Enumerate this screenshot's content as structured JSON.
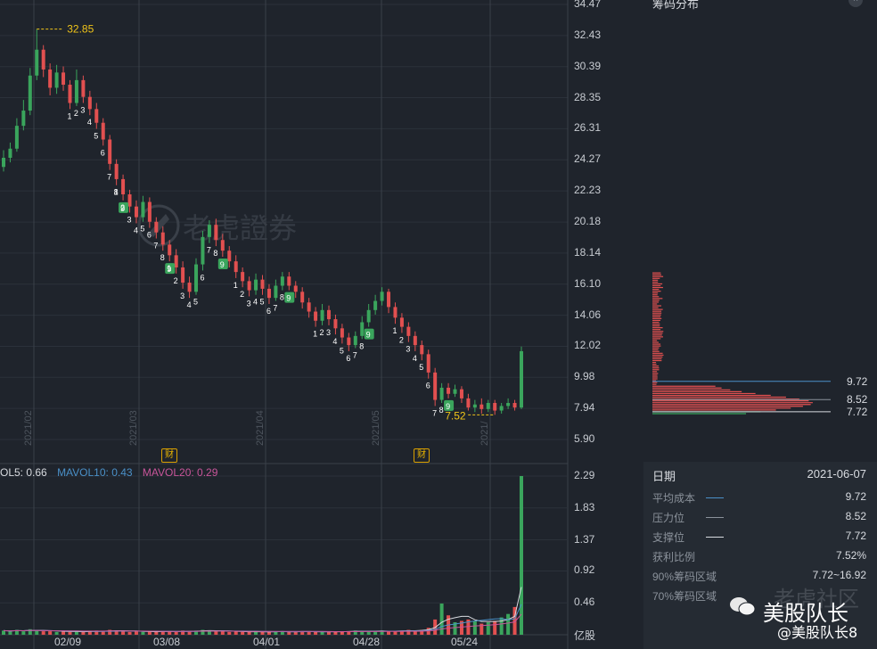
{
  "app": {
    "watermark_text": "老虎證券"
  },
  "price_axis": [
    "34.47",
    "32.43",
    "30.39",
    "28.35",
    "26.31",
    "24.27",
    "22.23",
    "20.18",
    "18.14",
    "16.10",
    "14.06",
    "12.02",
    "9.98",
    "7.94",
    "5.90"
  ],
  "volume_axis": [
    "2.29",
    "1.83",
    "1.37",
    "0.92",
    "0.46",
    "亿股"
  ],
  "x_dates": [
    "02/09",
    "03/08",
    "04/01",
    "04/28",
    "05/24"
  ],
  "month_markers": [
    "2021/02",
    "2021/03",
    "2021/04",
    "2021/05",
    "2021/"
  ],
  "price_annotations": {
    "high": "32.85",
    "low": "7.52"
  },
  "fin_badge": "财",
  "volume_legend": {
    "mavol5": "OL5: 0.66",
    "mavol10": "MAVOL10: 0.43",
    "mavol20": "MAVOL20: 0.29"
  },
  "colors": {
    "up": "#3aa55c",
    "down": "#e25050",
    "ma5": "#d8dbe0",
    "ma10": "#4a90c8",
    "ma20": "#c8559a",
    "accent": "#f0c419"
  },
  "chip_panel": {
    "title": "筹码分布",
    "close_icon": "close-icon",
    "levels": [
      "9.72",
      "8.52",
      "7.72"
    ],
    "date_label": "日期",
    "date_value": "2021-06-07",
    "rows": [
      {
        "label": "平均成本",
        "value": "9.72"
      },
      {
        "label": "压力位",
        "value": "8.52"
      },
      {
        "label": "支撑位",
        "value": "7.72"
      },
      {
        "label": "获利比例",
        "value": "7.52%"
      },
      {
        "label": "90%筹码区域",
        "value": "7.72~16.92"
      },
      {
        "label": "70%筹码区域",
        "value": "~?"
      }
    ]
  },
  "footer_watermark": {
    "line1": "老虎社区",
    "line2": "美股队长",
    "line3": "@美股队长8"
  },
  "chart_data": {
    "type": "candlestick",
    "price_range": [
      5.9,
      34.47
    ],
    "volume_range": [
      0,
      2.29
    ],
    "sequence_labels": [
      "1",
      "2",
      "3",
      "4",
      "5",
      "6",
      "7",
      "8",
      "9"
    ],
    "candles": [
      [
        23.8,
        24.4,
        24.9,
        23.5
      ],
      [
        24.4,
        25.0,
        25.4,
        24.1
      ],
      [
        25.0,
        26.5,
        27.0,
        24.8
      ],
      [
        26.5,
        27.5,
        28.2,
        26.2
      ],
      [
        27.5,
        29.8,
        30.3,
        27.2
      ],
      [
        29.8,
        31.5,
        32.85,
        29.5
      ],
      [
        31.5,
        30.2,
        31.8,
        29.7
      ],
      [
        30.2,
        29.0,
        30.6,
        28.5
      ],
      [
        29.0,
        30.0,
        30.5,
        28.6
      ],
      [
        30.0,
        29.2,
        30.4,
        28.8
      ],
      [
        29.2,
        28.0,
        29.5,
        27.6
      ],
      [
        28.0,
        29.5,
        30.2,
        27.8
      ],
      [
        29.5,
        28.4,
        29.8,
        28.0
      ],
      [
        28.4,
        27.6,
        28.8,
        27.2
      ],
      [
        27.6,
        26.7,
        28.0,
        26.3
      ],
      [
        26.7,
        25.6,
        27.0,
        25.2
      ],
      [
        25.6,
        24.0,
        25.9,
        23.6
      ],
      [
        24.0,
        23.0,
        24.3,
        22.6
      ],
      [
        23.0,
        22.0,
        23.3,
        21.6
      ],
      [
        22.0,
        21.2,
        22.3,
        20.8
      ],
      [
        21.2,
        20.5,
        21.6,
        20.1
      ],
      [
        20.5,
        21.5,
        21.9,
        20.2
      ],
      [
        21.5,
        20.2,
        21.8,
        19.8
      ],
      [
        20.2,
        19.5,
        20.5,
        19.1
      ],
      [
        19.5,
        18.7,
        19.9,
        18.3
      ],
      [
        18.7,
        18.0,
        19.0,
        17.6
      ],
      [
        18.0,
        17.2,
        18.4,
        16.8
      ],
      [
        17.2,
        16.2,
        17.6,
        15.8
      ],
      [
        16.2,
        15.6,
        16.6,
        15.2
      ],
      [
        15.6,
        17.4,
        17.8,
        15.4
      ],
      [
        17.4,
        19.2,
        19.6,
        17.0
      ],
      [
        19.2,
        20.0,
        20.3,
        18.8
      ],
      [
        20.0,
        19.0,
        20.4,
        18.6
      ],
      [
        19.0,
        18.3,
        19.4,
        17.9
      ],
      [
        18.3,
        17.6,
        18.6,
        17.2
      ],
      [
        17.6,
        16.9,
        18.0,
        16.5
      ],
      [
        16.9,
        16.3,
        17.2,
        15.9
      ],
      [
        16.3,
        15.7,
        16.6,
        15.3
      ],
      [
        15.7,
        16.4,
        16.8,
        15.4
      ],
      [
        16.4,
        15.8,
        16.7,
        15.4
      ],
      [
        15.8,
        15.2,
        16.1,
        14.8
      ],
      [
        15.2,
        16.0,
        16.4,
        15.0
      ],
      [
        16.0,
        16.6,
        16.9,
        15.7
      ],
      [
        16.6,
        16.0,
        16.9,
        15.7
      ],
      [
        16.0,
        15.6,
        16.3,
        15.2
      ],
      [
        15.6,
        14.9,
        15.9,
        14.5
      ],
      [
        14.9,
        14.3,
        15.2,
        13.9
      ],
      [
        14.3,
        13.7,
        14.6,
        13.3
      ],
      [
        13.7,
        14.4,
        14.8,
        13.4
      ],
      [
        14.4,
        13.8,
        14.7,
        13.4
      ],
      [
        13.8,
        13.2,
        14.1,
        12.8
      ],
      [
        13.2,
        12.6,
        13.5,
        12.2
      ],
      [
        12.6,
        12.1,
        12.9,
        11.7
      ],
      [
        12.1,
        12.7,
        13.0,
        11.9
      ],
      [
        12.7,
        13.6,
        14.0,
        12.5
      ],
      [
        13.6,
        14.4,
        14.8,
        13.3
      ],
      [
        14.4,
        15.0,
        15.4,
        14.1
      ],
      [
        15.0,
        15.6,
        15.9,
        14.7
      ],
      [
        15.6,
        14.6,
        15.8,
        14.2
      ],
      [
        14.6,
        13.9,
        14.9,
        13.5
      ],
      [
        13.9,
        13.3,
        14.2,
        12.9
      ],
      [
        13.3,
        12.7,
        13.6,
        12.3
      ],
      [
        12.7,
        12.1,
        13.0,
        11.7
      ],
      [
        12.1,
        11.5,
        12.4,
        11.1
      ],
      [
        11.5,
        10.3,
        11.8,
        9.9
      ],
      [
        10.3,
        8.5,
        10.6,
        8.1
      ],
      [
        8.5,
        9.3,
        9.6,
        8.3
      ],
      [
        9.3,
        8.9,
        9.6,
        8.6
      ],
      [
        8.9,
        9.2,
        9.5,
        8.7
      ],
      [
        9.2,
        8.6,
        9.4,
        8.3
      ],
      [
        8.6,
        8.0,
        8.9,
        7.8
      ],
      [
        8.0,
        8.2,
        8.5,
        7.7
      ],
      [
        8.2,
        7.9,
        8.6,
        7.6
      ],
      [
        7.9,
        8.3,
        8.5,
        7.7
      ],
      [
        8.3,
        7.8,
        8.5,
        7.52
      ],
      [
        7.8,
        8.1,
        8.3,
        7.6
      ],
      [
        8.1,
        8.3,
        8.6,
        7.9
      ],
      [
        8.3,
        8.0,
        8.5,
        7.8
      ],
      [
        8.0,
        11.7,
        12.0,
        7.9
      ]
    ],
    "volumes": [
      0.06,
      0.05,
      0.07,
      0.05,
      0.08,
      0.06,
      0.05,
      0.05,
      0.04,
      0.05,
      0.04,
      0.05,
      0.04,
      0.05,
      0.06,
      0.05,
      0.07,
      0.06,
      0.05,
      0.04,
      0.05,
      0.04,
      0.05,
      0.04,
      0.05,
      0.05,
      0.04,
      0.06,
      0.05,
      0.06,
      0.07,
      0.06,
      0.05,
      0.05,
      0.04,
      0.05,
      0.04,
      0.04,
      0.05,
      0.04,
      0.04,
      0.05,
      0.05,
      0.04,
      0.04,
      0.05,
      0.05,
      0.04,
      0.04,
      0.04,
      0.05,
      0.05,
      0.05,
      0.06,
      0.05,
      0.05,
      0.05,
      0.06,
      0.05,
      0.05,
      0.06,
      0.07,
      0.06,
      0.07,
      0.1,
      0.22,
      0.45,
      0.28,
      0.18,
      0.2,
      0.22,
      0.2,
      0.16,
      0.18,
      0.2,
      0.25,
      0.3,
      0.4,
      2.29
    ]
  }
}
